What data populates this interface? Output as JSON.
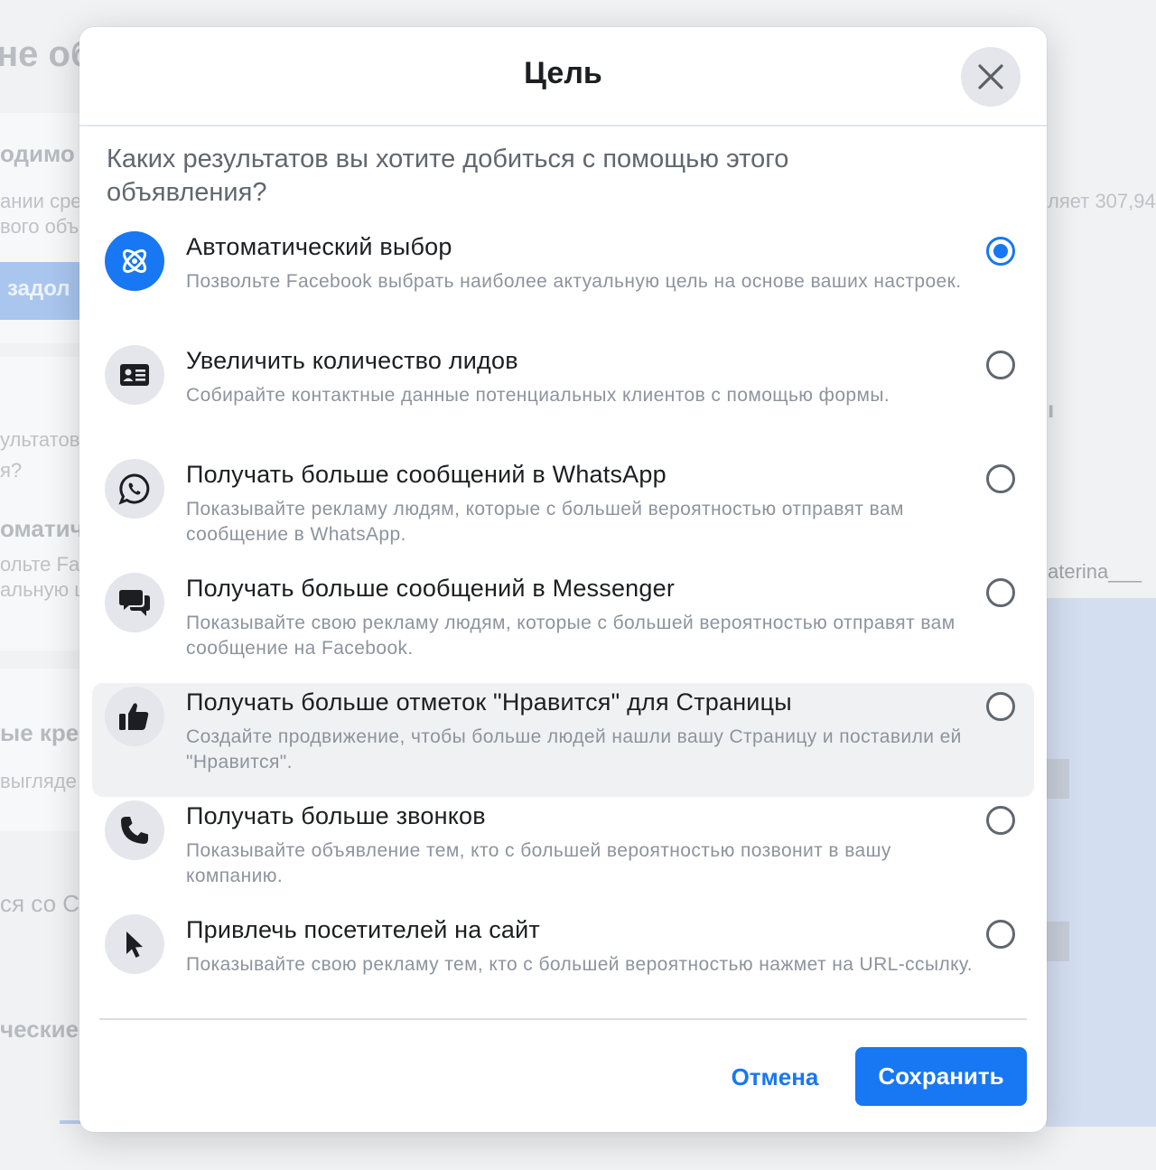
{
  "background": {
    "title_fragment": "не об",
    "lines": [
      "одимо с",
      "ании сре",
      "вого объ",
      "ультатов",
      "я?",
      "оматич",
      "ольте Fa",
      "альную ц",
      "ые кре",
      "выгляде",
      "ся со С",
      "ческие"
    ],
    "button_fragment": "задол",
    "right_text_1": "ляет 307,94",
    "right_text_2": "aterina___",
    "right_text_3": "ı"
  },
  "modal": {
    "title": "Цель",
    "question": "Каких результатов вы хотите добиться с помощью этого объявления?",
    "options": [
      {
        "title": "Автоматический выбор",
        "description": "Позвольте Facebook выбрать наиболее актуальную цель на основе ваших настроек.",
        "icon": "atom-icon",
        "selected": true
      },
      {
        "title": "Увеличить количество лидов",
        "description": "Собирайте контактные данные потенциальных клиентов с помощью формы.",
        "icon": "contact-card-icon",
        "selected": false
      },
      {
        "title": "Получать больше сообщений в WhatsApp",
        "description": "Показывайте рекламу людям, которые с большей вероятностью отправят вам сообщение в WhatsApp.",
        "icon": "whatsapp-icon",
        "selected": false
      },
      {
        "title": "Получать больше сообщений в Messenger",
        "description": "Показывайте свою рекламу людям, которые с большей вероятностью отправят вам сообщение на Facebook.",
        "icon": "chat-bubbles-icon",
        "selected": false
      },
      {
        "title": "Получать больше отметок \"Нравится\" для Страницы",
        "description": "Создайте продвижение, чтобы больше людей нашли вашу Страницу и поставили ей \"Нравится\".",
        "icon": "thumbs-up-icon",
        "selected": false
      },
      {
        "title": "Получать больше звонков",
        "description": "Показывайте объявление тем, кто с большей вероятностью позвонит в вашу компанию.",
        "icon": "phone-icon",
        "selected": false
      },
      {
        "title": "Привлечь посетителей на сайт",
        "description": "Показывайте свою рекламу тем, кто с большей вероятностью нажмет на URL-ссылку.",
        "icon": "cursor-icon",
        "selected": false
      }
    ],
    "cancel_label": "Отмена",
    "save_label": "Сохранить"
  },
  "colors": {
    "accent": "#1877f2",
    "text_primary": "#1c1e21",
    "text_secondary": "#8d949e",
    "icon_bg": "#e4e6eb"
  }
}
